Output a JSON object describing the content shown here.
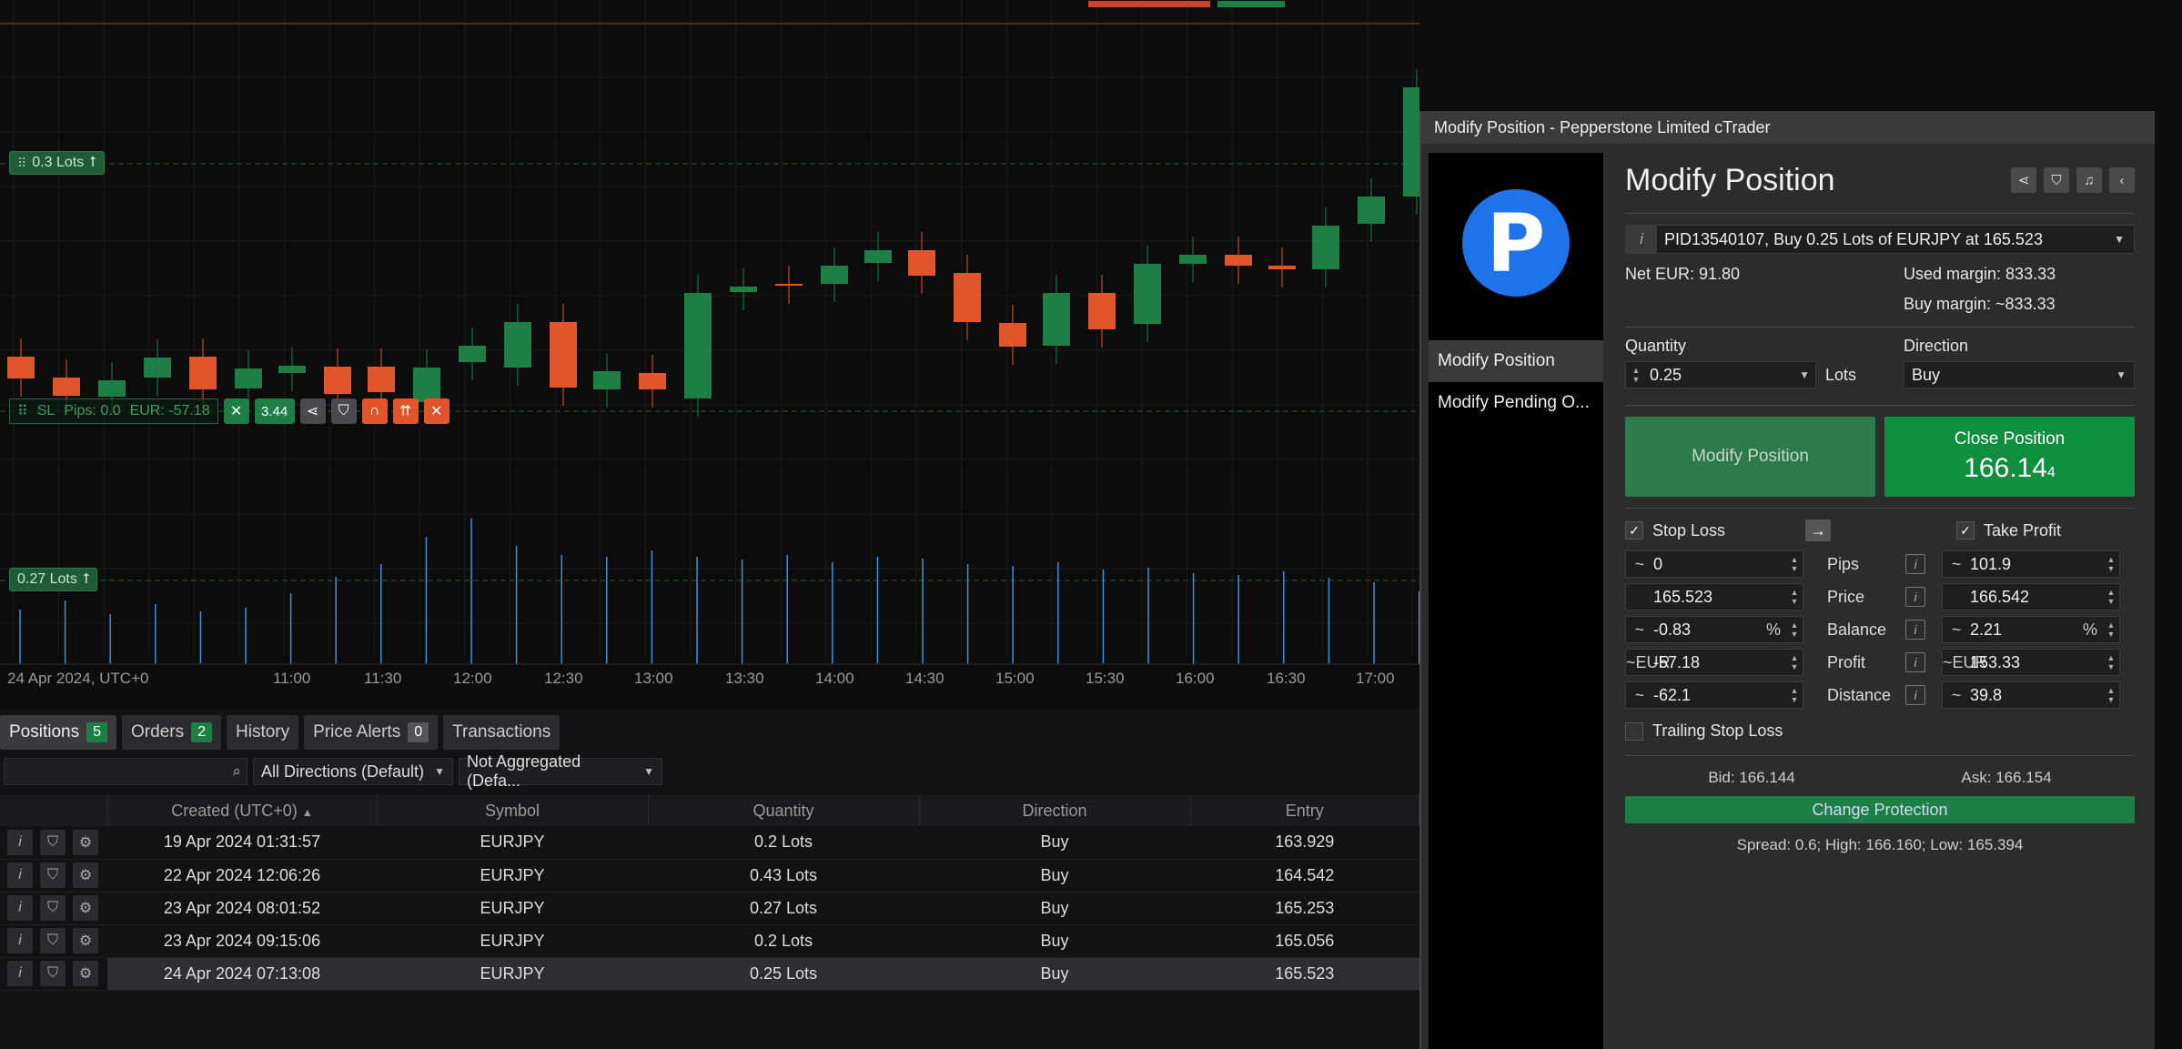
{
  "chart": {
    "lot_tag_top": "0.3 Lots",
    "lot_tag_bottom": "0.27 Lots",
    "sl_label": "SL",
    "sl_pips": "Pips: 0.0",
    "sl_eur": "EUR: -57.18",
    "sl_price_fragment": "3.44",
    "time_labels": [
      "24 Apr 2024, UTC+0",
      "11:00",
      "11:30",
      "12:00",
      "12:30",
      "13:00",
      "13:30",
      "14:00",
      "14:30",
      "15:00",
      "15:30",
      "16:00",
      "16:30",
      "17:00"
    ],
    "colors": {
      "up": "#1d7f46",
      "down": "#e0552a",
      "volume": "#3b8fd8"
    }
  },
  "bottom": {
    "tabs": [
      {
        "label": "Positions",
        "badge": "5"
      },
      {
        "label": "Orders",
        "badge": "2"
      },
      {
        "label": "History",
        "badge": ""
      },
      {
        "label": "Price Alerts",
        "badge": "0"
      },
      {
        "label": "Transactions",
        "badge": ""
      }
    ],
    "search_placeholder": "",
    "filter_direction": "All Directions (Default)",
    "filter_aggregation": "Not Aggregated (Defa...",
    "columns": [
      "Created (UTC+0)",
      "Symbol",
      "Quantity",
      "Direction",
      "Entry"
    ],
    "rows": [
      {
        "created": "19 Apr 2024 01:31:57",
        "symbol": "EURJPY",
        "quantity": "0.2 Lots",
        "direction": "Buy",
        "entry": "163.929"
      },
      {
        "created": "22 Apr 2024 12:06:26",
        "symbol": "EURJPY",
        "quantity": "0.43 Lots",
        "direction": "Buy",
        "entry": "164.542"
      },
      {
        "created": "23 Apr 2024 08:01:52",
        "symbol": "EURJPY",
        "quantity": "0.27 Lots",
        "direction": "Buy",
        "entry": "165.253"
      },
      {
        "created": "23 Apr 2024 09:15:06",
        "symbol": "EURJPY",
        "quantity": "0.2 Lots",
        "direction": "Buy",
        "entry": "165.056"
      },
      {
        "created": "24 Apr 2024 07:13:08",
        "symbol": "EURJPY",
        "quantity": "0.25 Lots",
        "direction": "Buy",
        "entry": "165.523"
      }
    ]
  },
  "modal": {
    "window_title": "Modify Position - Pepperstone Limited cTrader",
    "logo_letter": "P",
    "side_items": [
      "Modify Position",
      "Modify Pending O..."
    ],
    "heading": "Modify Position",
    "position_select": "PID13540107, Buy  0.25 Lots  of EURJPY at 165.523",
    "net": "Net EUR: 91.80",
    "used_margin": "Used margin: 833.33",
    "buy_margin": "Buy margin: ~833.33",
    "quantity_label": "Quantity",
    "quantity_value": "0.25",
    "quantity_unit": "Lots",
    "direction_label": "Direction",
    "direction_value": "Buy",
    "modify_button": "Modify Position",
    "close_button": "Close Position",
    "close_price_main": "166.14",
    "close_price_pip": "4",
    "stop_loss_label": "Stop Loss",
    "take_profit_label": "Take Profit",
    "rows": [
      {
        "label": "Pips",
        "sl_prefix": "~",
        "sl": "0",
        "sl_unit": "",
        "tp_prefix": "~",
        "tp": "101.9",
        "tp_unit": ""
      },
      {
        "label": "Price",
        "sl_prefix": "",
        "sl": "165.523",
        "sl_unit": "",
        "tp_prefix": "",
        "tp": "166.542",
        "tp_unit": ""
      },
      {
        "label": "Balance",
        "sl_prefix": "~",
        "sl": "-0.83",
        "sl_unit": "%",
        "tp_prefix": "~",
        "tp": "2.21",
        "tp_unit": "%"
      },
      {
        "label": "Profit",
        "sl_prefix": "~EUR",
        "sl": "-57.18",
        "sl_unit": "",
        "tp_prefix": "~EUR",
        "tp": "153.33",
        "tp_unit": ""
      },
      {
        "label": "Distance",
        "sl_prefix": "~",
        "sl": "-62.1",
        "sl_unit": "",
        "tp_prefix": "~",
        "tp": "39.8",
        "tp_unit": ""
      }
    ],
    "trailing_label": "Trailing Stop Loss",
    "bid": "Bid: 166.144",
    "ask": "Ask: 166.154",
    "change_protection": "Change Protection",
    "spread": "Spread: 0.6; High: 166.160; Low: 165.394"
  }
}
